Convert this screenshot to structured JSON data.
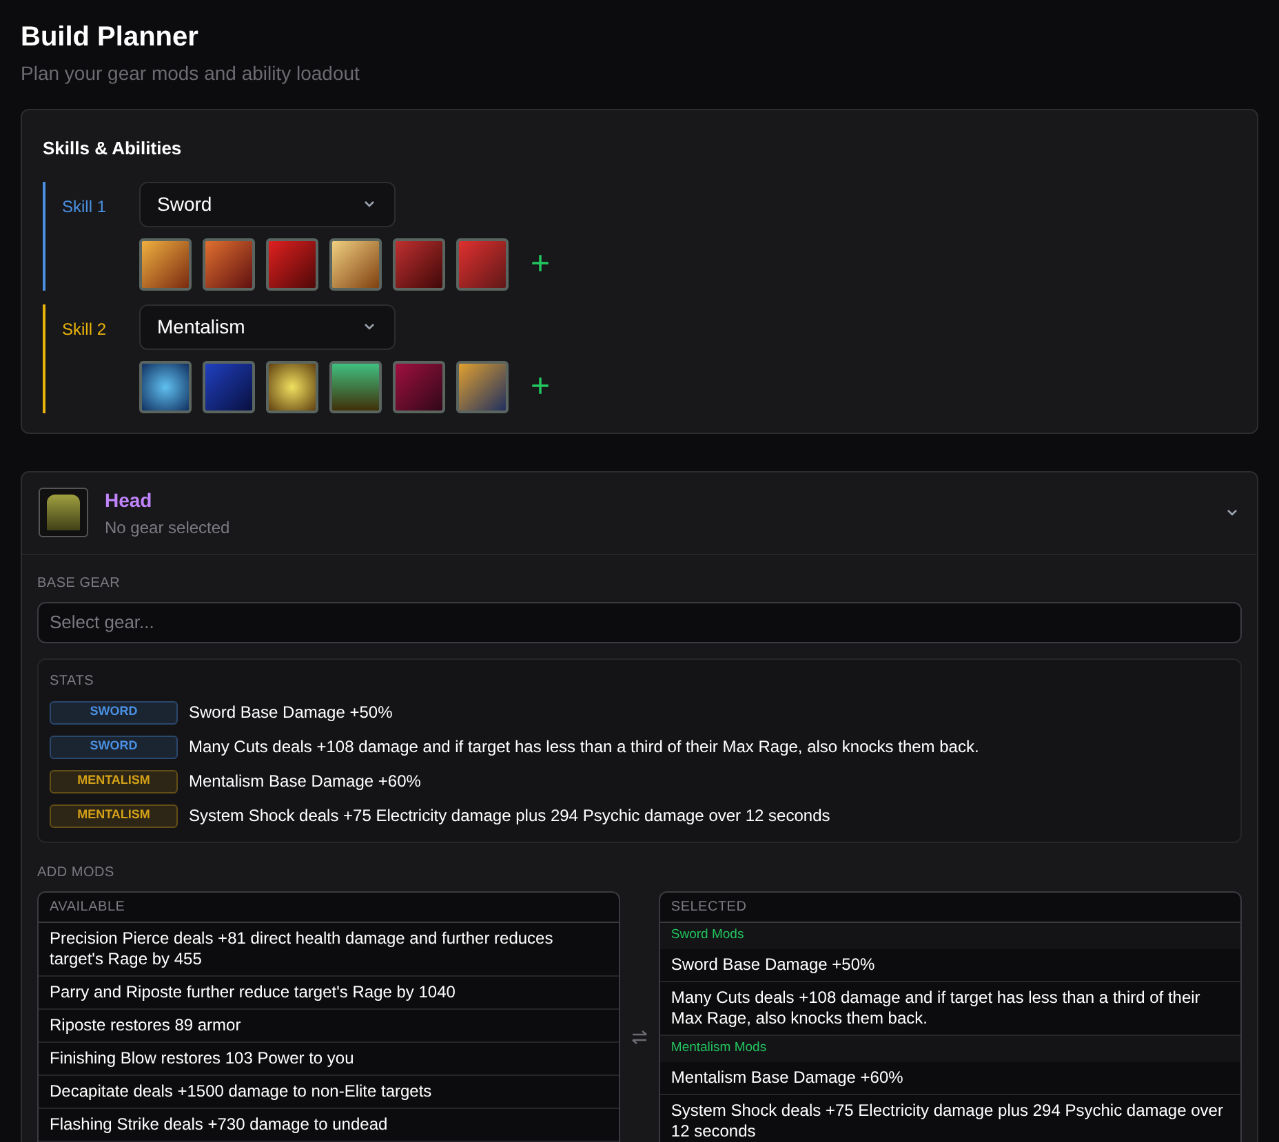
{
  "header": {
    "title": "Build Planner",
    "subtitle": "Plan your gear mods and ability loadout"
  },
  "skills_panel": {
    "title": "Skills & Abilities",
    "skills": [
      {
        "label": "Skill 1",
        "color": "#4a90e2",
        "dropdown": {
          "value": "Sword"
        },
        "add_button": "+"
      },
      {
        "label": "Skill 2",
        "color": "#eab308",
        "dropdown": {
          "value": "Mentalism"
        },
        "add_button": "+"
      }
    ]
  },
  "gear_slot": {
    "title": "Head",
    "subtitle": "No gear selected",
    "expanded": true,
    "base_gear": {
      "label": "BASE GEAR",
      "placeholder": "Select gear..."
    },
    "stats": {
      "label": "STATS",
      "rows": [
        {
          "tag": "SWORD",
          "color": "#4a90e2",
          "text": "Sword Base Damage +50%"
        },
        {
          "tag": "SWORD",
          "color": "#4a90e2",
          "text": "Many Cuts deals +108 damage and if target has less than a third of their Max Rage, also knocks them back."
        },
        {
          "tag": "MENTALISM",
          "color": "#d4a017",
          "text": "Mentalism Base Damage +60%"
        },
        {
          "tag": "MENTALISM",
          "color": "#d4a017",
          "text": "System Shock deals +75 Electricity damage plus 294 Psychic damage over 12 seconds"
        }
      ]
    },
    "add_mods": {
      "label": "ADD MODS",
      "available": {
        "heading": "AVAILABLE",
        "items": [
          "Precision Pierce deals +81 direct health damage and further reduces target's Rage by 455",
          "Parry and Riposte further reduce target's Rage by 1040",
          "Riposte restores 89 armor",
          "Finishing Blow restores 103 Power to you",
          "Decapitate deals +1500 damage to non-Elite targets",
          "Flashing Strike deals +730 damage to undead"
        ]
      },
      "selected": {
        "heading": "SELECTED",
        "groups": [
          {
            "title": "Sword Mods",
            "items": [
              "Sword Base Damage +50%",
              "Many Cuts deals +108 damage and if target has less than a third of their Max Rage, also knocks them back."
            ]
          },
          {
            "title": "Mentalism Mods",
            "items": [
              "Mentalism Base Damage +60%",
              "System Shock deals +75 Electricity damage plus 294 Psychic damage over 12 seconds"
            ]
          }
        ]
      }
    }
  }
}
